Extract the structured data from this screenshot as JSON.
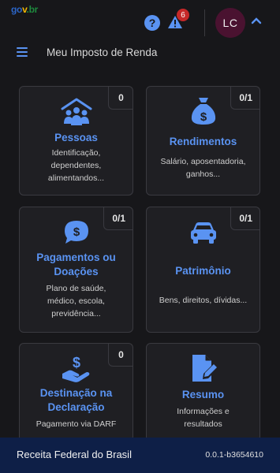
{
  "header": {
    "logo_parts": [
      "go",
      "v",
      ".br"
    ],
    "help_symbol": "?",
    "notification_count": "6",
    "user_initials": "LC"
  },
  "page": {
    "title": "Meu Imposto de Renda"
  },
  "cards": [
    {
      "title": "Pessoas",
      "count": "0",
      "description": "Identificação, dependentes, alimentandos...",
      "icon": "people-roof-icon"
    },
    {
      "title": "Rendimentos",
      "count": "0/1",
      "description": "Salário, aposentadoria, ganhos...",
      "icon": "money-bag-icon"
    },
    {
      "title": "Pagamentos ou Doações",
      "count": "0/1",
      "description": "Plano de saúde, médico, escola, previdência...",
      "icon": "dollar-chat-icon"
    },
    {
      "title": "Patrimônio",
      "count": "0/1",
      "description": "Bens, direitos, dívidas...",
      "icon": "car-icon"
    },
    {
      "title": "Destinação na Declaração",
      "count": "0",
      "description": "Pagamento via DARF",
      "icon": "hand-dollar-icon"
    },
    {
      "title": "Resumo",
      "count": "",
      "description": "Informações e resultados",
      "icon": "document-edit-icon"
    }
  ],
  "footer": {
    "org": "Receita Federal do Brasil",
    "version": "0.0.1-b3654610"
  },
  "colors": {
    "accent": "#5a93f2",
    "footer_bg": "#0e1f47",
    "badge": "#c62828",
    "avatar_bg": "#4a1230"
  }
}
